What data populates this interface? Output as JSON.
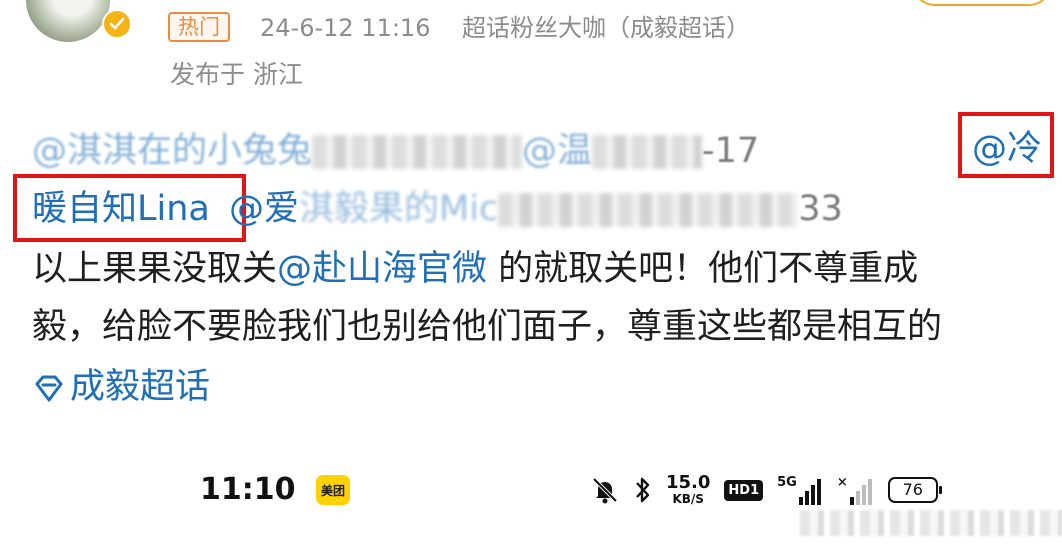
{
  "post_header": {
    "badge": "热门",
    "time": "24-6-12 11:16",
    "source": "超话粉丝大咖（成毅超话）",
    "published_from": "发布于 浙江"
  },
  "body": {
    "line1_start": "@淇淇在的小兔兔",
    "line1_mid": "@温",
    "line1_suffix": "-17",
    "mention_red_part1": "@冷",
    "mention_red_part2": "暖自知Lina",
    "line2_mention": "@爱",
    "line2_blur_text": "淇毅果的Mic",
    "line2_end": "33",
    "line3_prefix": "以上果果没取关",
    "line3_mention": "@赴山海官微",
    "line3_rest": " 的就取关吧！他们不尊重成",
    "line4": "毅，给脸不要脸我们也别给他们面子，尊重这些都是相互的",
    "topic": "成毅超话"
  },
  "status_bar": {
    "time": "11:10",
    "meituan": "美团",
    "net_speed_value": "15.0",
    "net_speed_unit": "KB/S",
    "hd": "HD1",
    "net_type": "5G",
    "battery": "76"
  },
  "colors": {
    "mention": "#1e6fb8",
    "highlight_box": "#e01515",
    "meta_text": "#8c8c8c",
    "hot_badge": "#f08a3c"
  },
  "icons": [
    "verified-icon",
    "topic-diamond-icon",
    "mute-bell-icon",
    "bluetooth-icon",
    "signal-icon",
    "battery-icon"
  ]
}
